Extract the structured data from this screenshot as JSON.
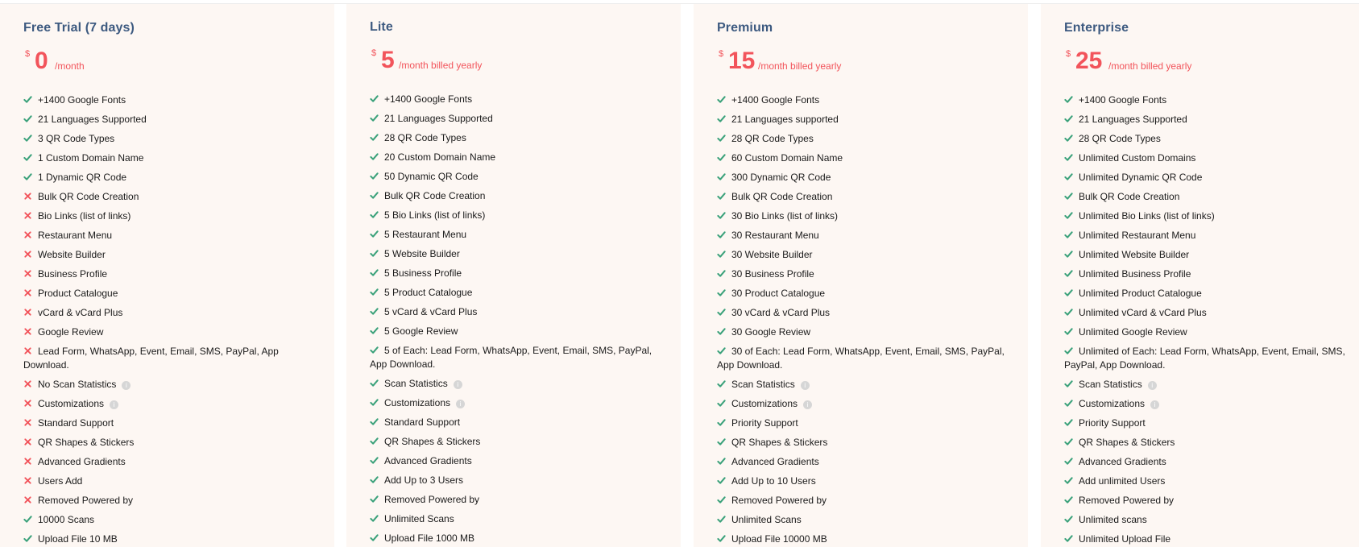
{
  "colors": {
    "card_bg": "#fdf7f3",
    "plan_name": "#3d5a80",
    "price": "#f2545b",
    "check": "#3aa17a",
    "cross": "#f2545b"
  },
  "plans": [
    {
      "name": "Free Trial (7 days)",
      "currency": "$",
      "amount": "0",
      "period": "/month",
      "features": [
        {
          "text": "+1400 Google Fonts",
          "ok": true
        },
        {
          "text": "21 Languages Supported",
          "ok": true
        },
        {
          "text": "3 QR Code Types",
          "ok": true
        },
        {
          "text": "1 Custom Domain Name",
          "ok": true
        },
        {
          "text": "1 Dynamic QR Code",
          "ok": true
        },
        {
          "text": "Bulk QR Code Creation",
          "ok": false
        },
        {
          "text": "Bio Links (list of links)",
          "ok": false
        },
        {
          "text": "Restaurant Menu",
          "ok": false
        },
        {
          "text": "Website Builder",
          "ok": false
        },
        {
          "text": "Business Profile",
          "ok": false
        },
        {
          "text": "Product Catalogue",
          "ok": false
        },
        {
          "text": "vCard & vCard Plus",
          "ok": false
        },
        {
          "text": "Google Review",
          "ok": false
        },
        {
          "text": "Lead Form, WhatsApp, Event, Email, SMS, PayPal, App Download.",
          "ok": false
        },
        {
          "text": "No Scan Statistics",
          "ok": false,
          "info": true
        },
        {
          "text": "Customizations",
          "ok": false,
          "info": true
        },
        {
          "text": "Standard Support",
          "ok": false
        },
        {
          "text": "QR Shapes & Stickers",
          "ok": false
        },
        {
          "text": "Advanced Gradients",
          "ok": false
        },
        {
          "text": "Users Add",
          "ok": false
        },
        {
          "text": "Removed Powered by",
          "ok": false
        },
        {
          "text": "10000 Scans",
          "ok": true
        },
        {
          "text": "Upload File 10 MB",
          "ok": true
        }
      ]
    },
    {
      "name": "Lite",
      "currency": "$",
      "amount": "5",
      "period": "/month billed yearly",
      "features": [
        {
          "text": "+1400 Google Fonts",
          "ok": true
        },
        {
          "text": "21 Languages Supported",
          "ok": true
        },
        {
          "text": "28 QR Code Types",
          "ok": true
        },
        {
          "text": "20 Custom Domain Name",
          "ok": true
        },
        {
          "text": "50 Dynamic QR Code",
          "ok": true
        },
        {
          "text": "Bulk QR Code Creation",
          "ok": true
        },
        {
          "text": "5 Bio Links (list of links)",
          "ok": true
        },
        {
          "text": "5 Restaurant Menu",
          "ok": true
        },
        {
          "text": "5 Website Builder",
          "ok": true
        },
        {
          "text": "5 Business Profile",
          "ok": true
        },
        {
          "text": "5 Product Catalogue",
          "ok": true
        },
        {
          "text": "5 vCard & vCard Plus",
          "ok": true
        },
        {
          "text": "5 Google Review",
          "ok": true
        },
        {
          "text": "5 of Each: Lead Form, WhatsApp, Event, Email, SMS, PayPal, App Download.",
          "ok": true
        },
        {
          "text": "Scan Statistics",
          "ok": true,
          "info": true
        },
        {
          "text": "Customizations",
          "ok": true,
          "info": true
        },
        {
          "text": "Standard Support",
          "ok": true
        },
        {
          "text": "QR Shapes & Stickers",
          "ok": true
        },
        {
          "text": "Advanced Gradients",
          "ok": true
        },
        {
          "text": "Add Up to 3 Users",
          "ok": true
        },
        {
          "text": "Removed Powered by",
          "ok": true
        },
        {
          "text": "Unlimited Scans",
          "ok": true
        },
        {
          "text": "Upload File 1000 MB",
          "ok": true
        }
      ]
    },
    {
      "name": "Premium",
      "currency": "$",
      "amount": "15",
      "period": "/month billed yearly",
      "features": [
        {
          "text": "+1400 Google Fonts",
          "ok": true
        },
        {
          "text": "21 Languages supported",
          "ok": true
        },
        {
          "text": "28 QR Code Types",
          "ok": true
        },
        {
          "text": "60 Custom Domain Name",
          "ok": true
        },
        {
          "text": "300 Dynamic QR Code",
          "ok": true
        },
        {
          "text": "Bulk QR Code Creation",
          "ok": true
        },
        {
          "text": "30 Bio Links (list of links)",
          "ok": true
        },
        {
          "text": "30 Restaurant Menu",
          "ok": true
        },
        {
          "text": "30 Website Builder",
          "ok": true
        },
        {
          "text": "30 Business Profile",
          "ok": true
        },
        {
          "text": "30 Product Catalogue",
          "ok": true
        },
        {
          "text": "30 vCard & vCard Plus",
          "ok": true
        },
        {
          "text": "30 Google Review",
          "ok": true
        },
        {
          "text": "30 of Each: Lead Form, WhatsApp, Event, Email, SMS, PayPal, App Download.",
          "ok": true
        },
        {
          "text": "Scan Statistics",
          "ok": true,
          "info": true
        },
        {
          "text": "Customizations",
          "ok": true,
          "info": true
        },
        {
          "text": "Priority Support",
          "ok": true
        },
        {
          "text": "QR Shapes & Stickers",
          "ok": true
        },
        {
          "text": "Advanced Gradients",
          "ok": true
        },
        {
          "text": "Add Up to 10 Users",
          "ok": true
        },
        {
          "text": "Removed Powered by",
          "ok": true
        },
        {
          "text": "Unlimited Scans",
          "ok": true
        },
        {
          "text": "Upload File 10000 MB",
          "ok": true
        }
      ]
    },
    {
      "name": "Enterprise",
      "currency": "$",
      "amount": "25",
      "period": "/month billed yearly",
      "features": [
        {
          "text": "+1400 Google Fonts",
          "ok": true
        },
        {
          "text": "21 Languages Supported",
          "ok": true
        },
        {
          "text": "28 QR Code Types",
          "ok": true
        },
        {
          "text": "Unlimited Custom Domains",
          "ok": true
        },
        {
          "text": "Unlimited Dynamic QR Code",
          "ok": true
        },
        {
          "text": "Bulk QR Code Creation",
          "ok": true
        },
        {
          "text": "Unlimited Bio Links (list of links)",
          "ok": true
        },
        {
          "text": "Unlimited Restaurant Menu",
          "ok": true
        },
        {
          "text": "Unlimited Website Builder",
          "ok": true
        },
        {
          "text": "Unlimited Business Profile",
          "ok": true
        },
        {
          "text": "Unlimited Product Catalogue",
          "ok": true
        },
        {
          "text": "Unlimited vCard & vCard Plus",
          "ok": true
        },
        {
          "text": "Unlimited Google Review",
          "ok": true
        },
        {
          "text": "Unlimited of Each: Lead Form, WhatsApp, Event, Email, SMS, PayPal, App Download.",
          "ok": true
        },
        {
          "text": "Scan Statistics",
          "ok": true,
          "info": true
        },
        {
          "text": "Customizations",
          "ok": true,
          "info": true
        },
        {
          "text": "Priority Support",
          "ok": true
        },
        {
          "text": "QR Shapes & Stickers",
          "ok": true
        },
        {
          "text": "Advanced Gradients",
          "ok": true
        },
        {
          "text": "Add unlimited Users",
          "ok": true
        },
        {
          "text": "Removed Powered by",
          "ok": true
        },
        {
          "text": "Unlimited scans",
          "ok": true
        },
        {
          "text": "Unlimited Upload File",
          "ok": true
        }
      ]
    }
  ]
}
